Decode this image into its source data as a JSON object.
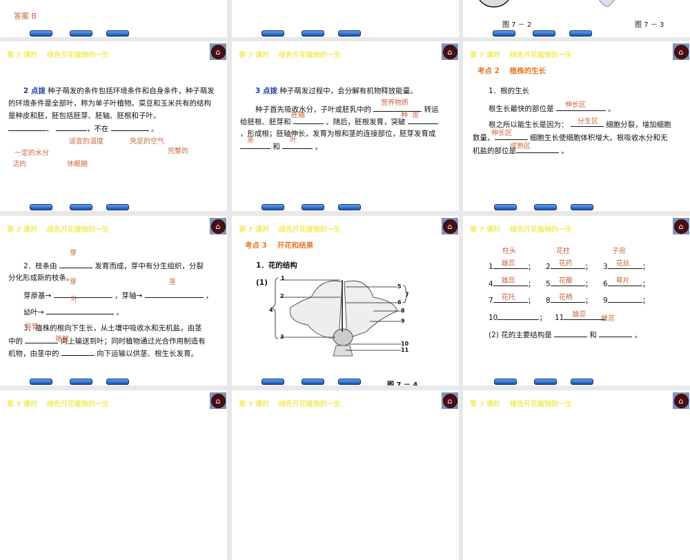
{
  "common": {
    "slide_title": "第 7 课时    绿色开花植物的一生"
  },
  "slide_top_1": {
    "answer": "答案 B"
  },
  "slide_top_3": {
    "fig_a": "图 7 － 2",
    "fig_b": "图 7 － 3",
    "label_a": "种 皮"
  },
  "slide_seed_conditions": {
    "line1_prefix": "2 点拨",
    "line1": " 种子萌发的条件包括环境条件和自身条件，种子萌发",
    "line2": "的环境条件是全部叶，称为单子叶植物。菜豆和玉米共有的结构",
    "line3": "是种皮和胚，胚包括胚芽、胚轴、胚根和子叶。",
    "line4_sep": "、",
    "line4_mid": "，不在",
    "line4_end": "。",
    "answers": [
      "适宜的温度",
      "充足的空气",
      "一定的水分",
      "完整的",
      "活的",
      "休眠期"
    ]
  },
  "slide_seed_germination": {
    "line1_prefix": "3 点拨",
    "line1": " 种子萌发过程中，会分解有机物释放能量。",
    "line2a": "种子首先吸收水分，子叶或胚乳中的 ",
    "line2b": " 转运",
    "line3a": "给胚根、胚芽和 ",
    "line3b": " 。随后，胚根发育，突破 ",
    "line4": "，形成根；胚轴伸长，发育为根和茎的连接部位，胚芽发育成",
    "line5a": " 和 ",
    "line5b": " 。",
    "answers": [
      "营养物质",
      "胚轴",
      "种  皮",
      "茎",
      "叶"
    ]
  },
  "slide_root_growth": {
    "heading": "考点 2    植株的生长",
    "sub": "1．根的生长",
    "line1": "根生长最快的部位是 ",
    "line1_end": " 。",
    "line2a": "根之所以能生长是因为： ",
    "line2b": " 细胞分裂，增加细胞",
    "line3a": "数量，",
    "line3b": " 细胞生长使细胞体积增大。根吸收水分和无",
    "line4a": "机盐的部位是",
    "line4b": " 。",
    "answers": [
      "伸长区",
      "分生区",
      "伸长区",
      "成熟区"
    ]
  },
  "slide_branch": {
    "line1a": "2．枝条由 ",
    "line1b": " 发育而成，芽中有分生组织，分裂",
    "line2": "分化形成新的枝条。",
    "line3a": "芽原基→ ",
    "line3b": " ，芽轴→ ",
    "line3c": " ，",
    "line4a": "幼叶→ ",
    "line4b": " 。",
    "line5": "3．植株的根向下生长，从土壤中吸收水和无机盐，由茎",
    "line6a": "中的 ",
    "line6b": " 向上输送到叶；同时植物通过光合作用制造有",
    "line7a": "机物，由茎中的 ",
    "line7b": " 向下运输以供茎、根生长发育。",
    "answers": [
      "芽",
      "芽",
      "茎",
      "叶",
      "导管",
      "筛管"
    ]
  },
  "slide_flower": {
    "heading": "考点 3    开花和结果",
    "sub": "1．花的结构",
    "q1": "(1)",
    "labels": [
      "1",
      "2",
      "3",
      "4",
      "5",
      "6",
      "7",
      "8",
      "9",
      "10",
      "11"
    ],
    "caption": "图 7 － 4"
  },
  "slide_flower_answers": {
    "top_answers": [
      "柱头",
      "花柱",
      "子房"
    ],
    "items": [
      {
        "num": "1",
        "ans": "雌蕊"
      },
      {
        "num": "2",
        "ans": "花药"
      },
      {
        "num": "3",
        "ans": "花丝"
      },
      {
        "num": "4",
        "ans": "雄蕊"
      },
      {
        "num": "5",
        "ans": "花瓣"
      },
      {
        "num": "6",
        "ans": "萼片"
      },
      {
        "num": "7",
        "ans": "花托"
      },
      {
        "num": "8",
        "ans": "花柄"
      },
      {
        "num": "9",
        "ans": ""
      },
      {
        "num": "10",
        "ans": ""
      },
      {
        "num": "11",
        "ans": "雄蕊"
      }
    ],
    "extra_answer": "雌蕊",
    "sep": "；",
    "q2a": "(2) 花的主要结构是 ",
    "q2b": " 和 ",
    "q2c": " 。"
  }
}
